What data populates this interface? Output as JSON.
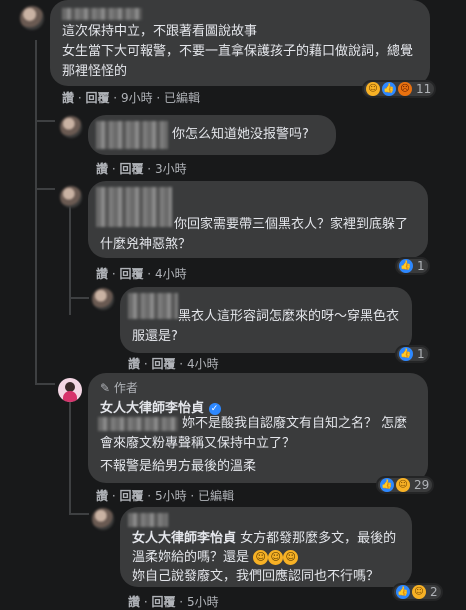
{
  "comments": [
    {
      "text": "這次保持中立，不跟著看圖說故事\n女生當下大可報警，不要一直拿保護孩子的藉口做說詞，總覺那裡怪怪的",
      "actions": {
        "like": "讚",
        "reply": "回覆",
        "time": "9小時",
        "edited": "已編輯"
      },
      "reactions": {
        "count": "11"
      }
    },
    {
      "text": "你怎么知道她没报警吗?",
      "actions": {
        "like": "讚",
        "reply": "回覆",
        "time": "3小時"
      }
    },
    {
      "text": "你回家需要帶三個黑衣人？家裡到底躲了什麼兇神惡煞？",
      "actions": {
        "like": "讚",
        "reply": "回覆",
        "time": "4小時"
      },
      "reactions": {
        "count": "1"
      }
    },
    {
      "text": "黑衣人這形容詞怎麼來的呀～穿黑色衣服還是?",
      "actions": {
        "like": "讚",
        "reply": "回覆",
        "time": "4小時"
      },
      "reactions": {
        "count": "1"
      }
    },
    {
      "author_tag": "作者",
      "author_name": "女人大律師李怡貞",
      "verified_mark": "✓",
      "text": "妳不是酸我自認廢文有自知之名？ 怎麼會來廢文粉專聲稱又保持中立了？",
      "text2": "不報警是給男方最後的溫柔",
      "actions": {
        "like": "讚",
        "reply": "回覆",
        "time": "5小時",
        "edited": "已編輯"
      },
      "reactions": {
        "count": "29"
      }
    },
    {
      "mention": "女人大律師李怡貞",
      "text": "女方都發那麼多文，最後的溫柔妳給的嗎？還是",
      "text2": "妳自己說發廢文，我們回應認同也不行嗎？",
      "actions": {
        "like": "讚",
        "reply": "回覆",
        "time": "5小時"
      },
      "reactions": {
        "count": "2"
      }
    }
  ],
  "icons": {
    "like": "thumbs-up-icon",
    "haha": "laughing-face-icon",
    "angry": "angry-face-icon",
    "pen": "pen-icon",
    "verified": "verified-badge-icon"
  },
  "colors": {
    "background": "#18191a",
    "bubble": "#3a3b3c",
    "like": "#2d88ff",
    "haha": "#f7b125",
    "angry": "#e9710f"
  }
}
